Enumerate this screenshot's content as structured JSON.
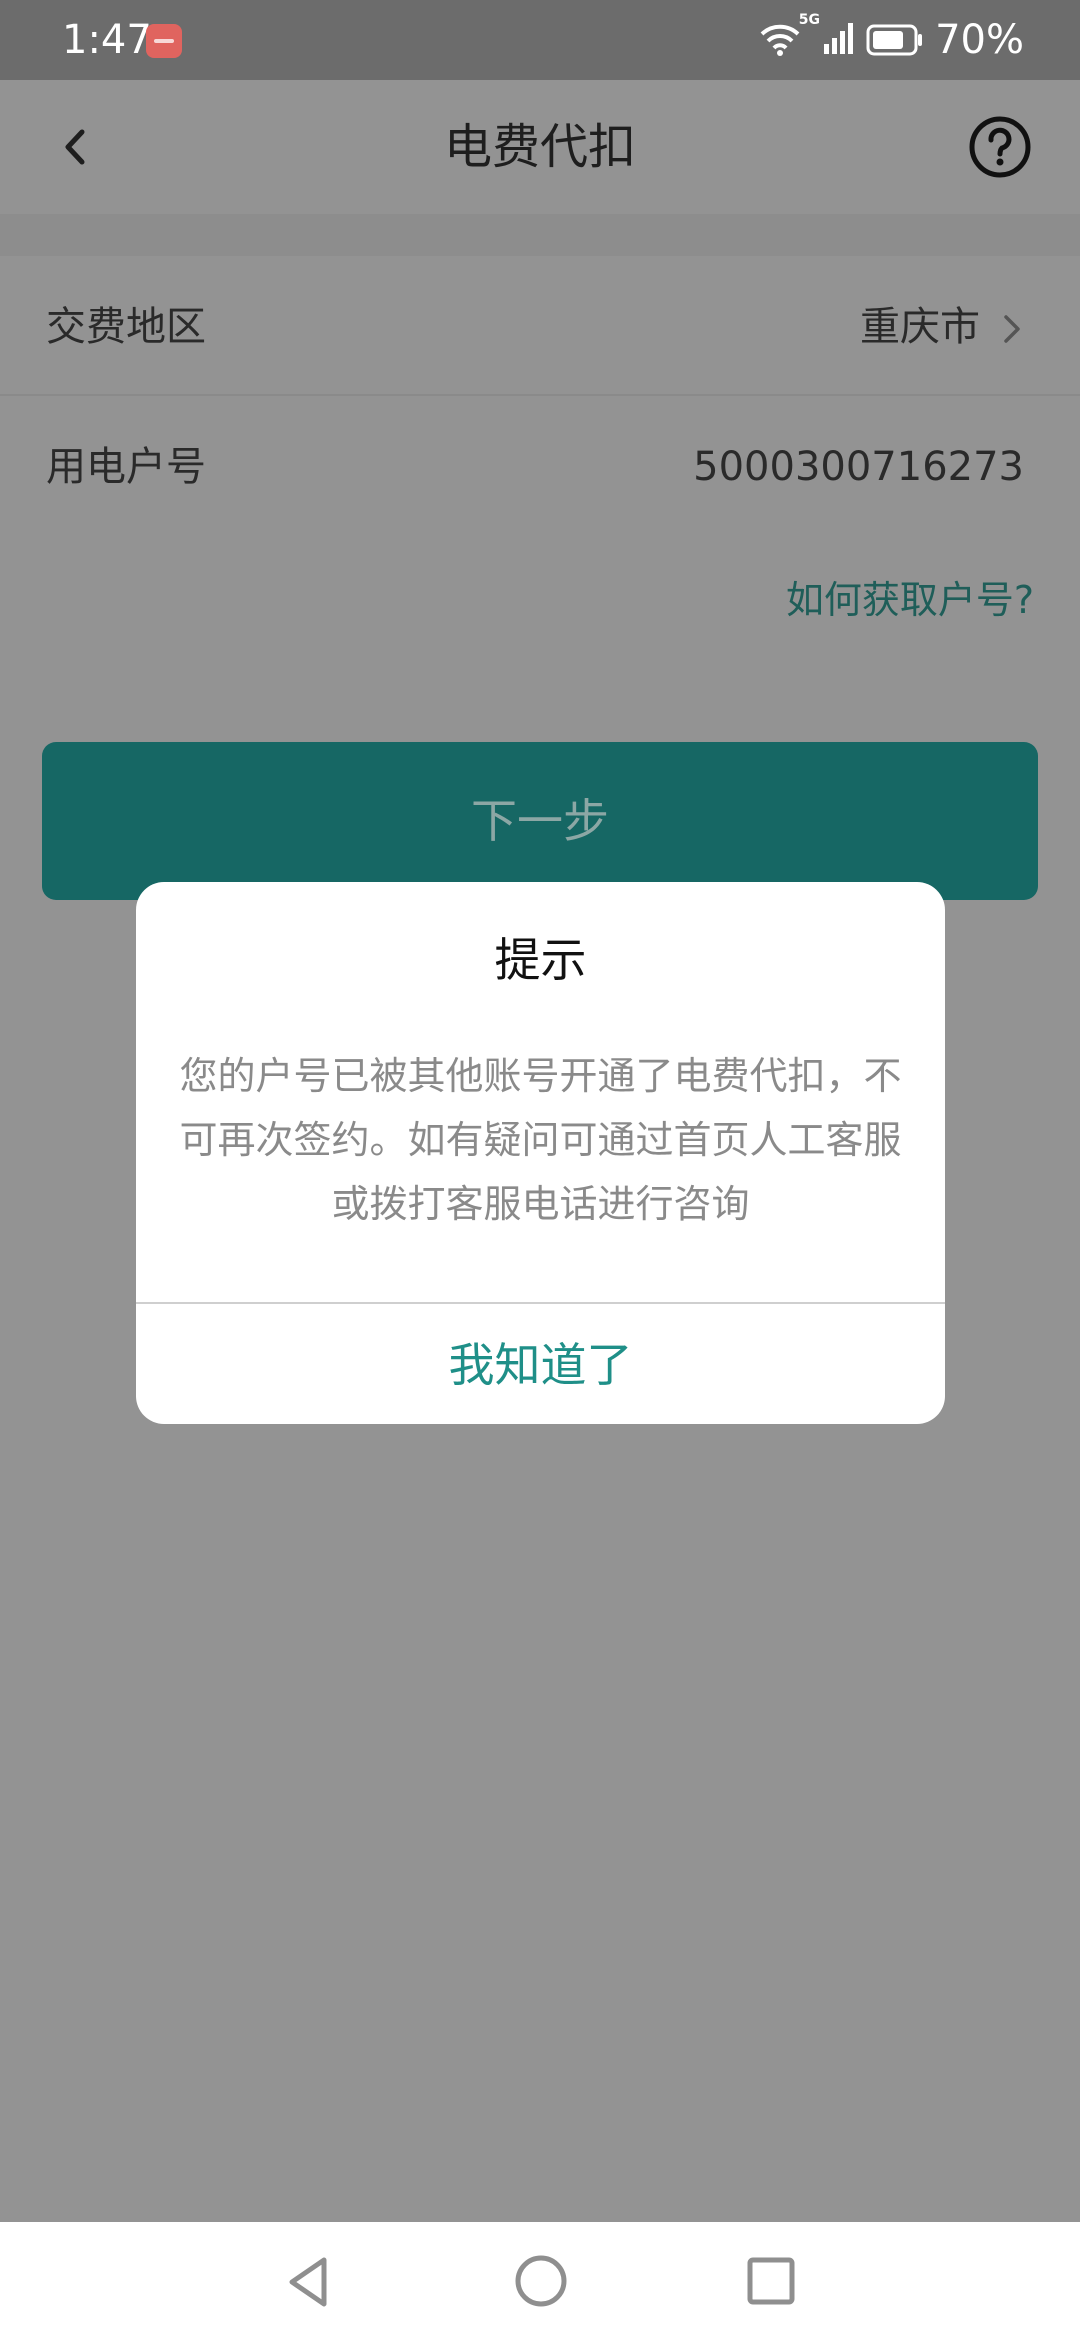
{
  "status_bar": {
    "time": "1:47",
    "network": "5G",
    "battery": "70%"
  },
  "header": {
    "title": "电费代扣",
    "back_icon": "chevron-left-icon",
    "help_icon": "question-circle-icon"
  },
  "form": {
    "region_label": "交费地区",
    "region_value": "重庆市",
    "account_label": "用电户号",
    "account_value": "5000300716273",
    "help_link": "如何获取户号?"
  },
  "next_button": {
    "label": "下一步",
    "color": "#166764"
  },
  "dialog": {
    "title": "提示",
    "message_lines": [
      "您的户号已被其他账号开通了电费代扣，不",
      "可再次签约。如有疑问可通过首页人工客服",
      "或拨打客服电话进行咨询"
    ],
    "confirm_label": "我知道了",
    "accent_color": "#1f8f88"
  },
  "navbar": {
    "back_icon": "triangle-back-icon",
    "home_icon": "circle-home-icon",
    "recents_icon": "square-recents-icon"
  }
}
